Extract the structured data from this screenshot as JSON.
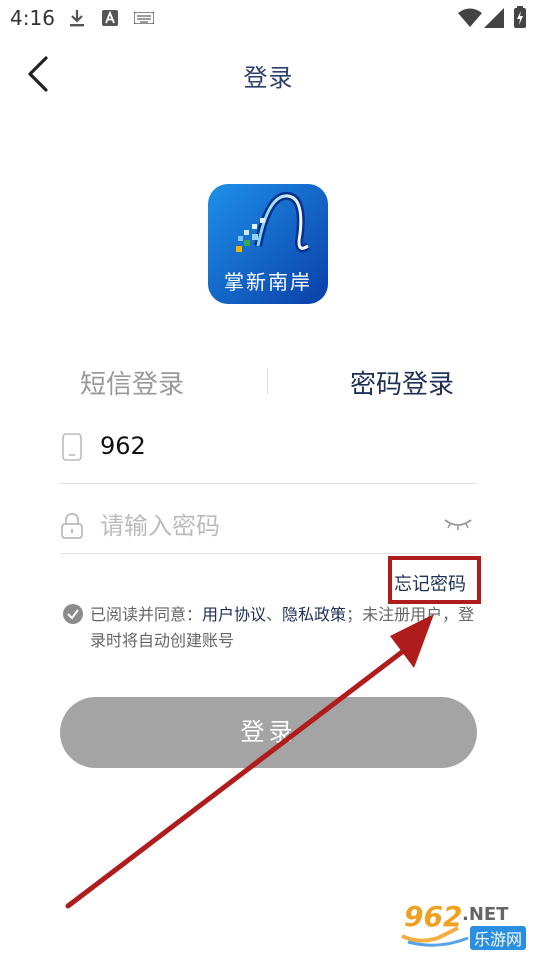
{
  "status_bar": {
    "time": "4:16"
  },
  "header": {
    "title": "登录",
    "back_icon": "chevron-left-icon"
  },
  "logo": {
    "text": "掌新南岸"
  },
  "tabs": [
    {
      "label": "短信登录",
      "active": false
    },
    {
      "label": "密码登录",
      "active": true
    }
  ],
  "form": {
    "phone_value": "962",
    "password_placeholder": "请输入密码",
    "forgot_label": "忘记密码"
  },
  "agreement": {
    "prefix": "已阅读并同意：",
    "user_agreement": "用户协议",
    "separator": "、",
    "privacy_policy": "隐私政策",
    "suffix": "；未注册用户，登录时将自动创建账号"
  },
  "login_button": {
    "label": "登录"
  },
  "watermark": {
    "brand": "962",
    "domain": ".NET",
    "site_name": "乐游网"
  },
  "colors": {
    "annotation_red": "#b01c1c",
    "title_navy": "#1f2f55",
    "button_gray": "#a4a4a4"
  }
}
